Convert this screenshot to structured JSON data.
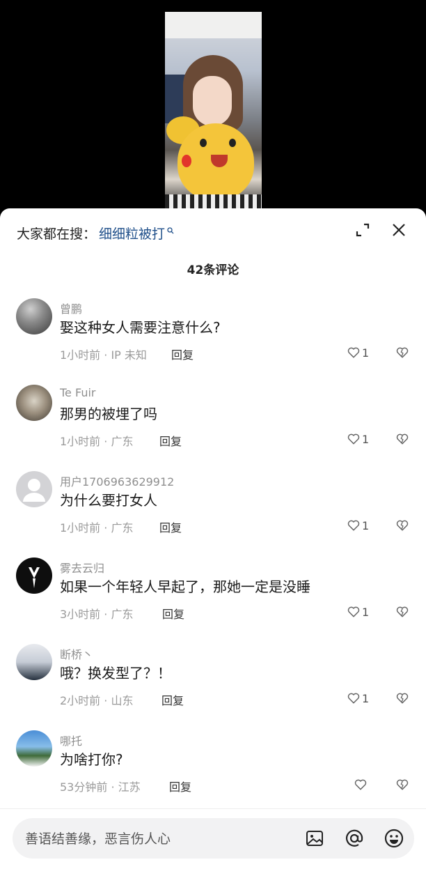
{
  "header": {
    "search_prefix": "大家都在搜：",
    "search_term": "细细粒被打"
  },
  "comment_count": "42条评论",
  "comments": [
    {
      "username": "曾鹏",
      "content": "娶这种女人需要注意什么?",
      "time": "1小时前",
      "location": "IP 未知",
      "reply": "回复",
      "likes": "1"
    },
    {
      "username": "Te Fuir",
      "content": "那男的被埋了吗",
      "time": "1小时前",
      "location": "广东",
      "reply": "回复",
      "likes": "1"
    },
    {
      "username": "用户1706963629912",
      "content": "为什么要打女人",
      "time": "1小时前",
      "location": "广东",
      "reply": "回复",
      "likes": "1"
    },
    {
      "username": "雾去云归",
      "content": "如果一个年轻人早起了，那她一定是没睡",
      "time": "3小时前",
      "location": "广东",
      "reply": "回复",
      "likes": "1"
    },
    {
      "username": "断桥丶",
      "content": "哦？换发型了？！",
      "time": "2小时前",
      "location": "山东",
      "reply": "回复",
      "likes": "1"
    },
    {
      "username": "哪托",
      "content": "为啥打你?",
      "time": "53分钟前",
      "location": "江苏",
      "reply": "回复",
      "likes": ""
    }
  ],
  "input": {
    "placeholder": "善语结善缘，恶言伤人心"
  },
  "icons": {
    "search": "search-icon",
    "expand": "expand-icon",
    "close": "close-icon",
    "like": "heart-icon",
    "dislike": "broken-heart-icon",
    "image": "image-icon",
    "at": "at-icon",
    "emoji": "emoji-icon"
  },
  "colors": {
    "search_term": "#1f4f8a",
    "meta_text": "#9a9a9a",
    "sheet_bg": "#ffffff",
    "backdrop": "#000000"
  }
}
